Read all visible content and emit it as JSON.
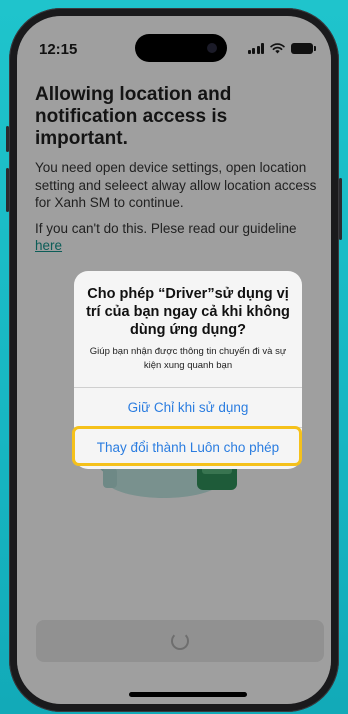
{
  "status_bar": {
    "time": "12:15"
  },
  "page": {
    "heading": "Allowing location and notification access is important.",
    "paragraph1": "You need open device settings, open location setting and seleect  alway allow location access for Xanh SM to continue.",
    "paragraph2": "If you can't do this. Plese read our guideline",
    "guideline_link": "here"
  },
  "alert": {
    "title": "Cho phép “Driver”sử dụng vị trí của bạn ngay cả khi không dùng ứng dụng?",
    "message": "Giúp bạn nhận được thông tin chuyến đi và sự kiện xung quanh bạn",
    "button_keep": "Giữ Chỉ khi sử dụng",
    "button_always": "Thay đổi thành Luôn cho phép"
  },
  "colors": {
    "background": "#1fc4cc",
    "link": "#138e86",
    "alert_button": "#2b7de0",
    "highlight": "#f5c11b"
  },
  "icons": [
    "signal-icon",
    "wifi-icon",
    "battery-icon",
    "loading-spinner-icon"
  ]
}
